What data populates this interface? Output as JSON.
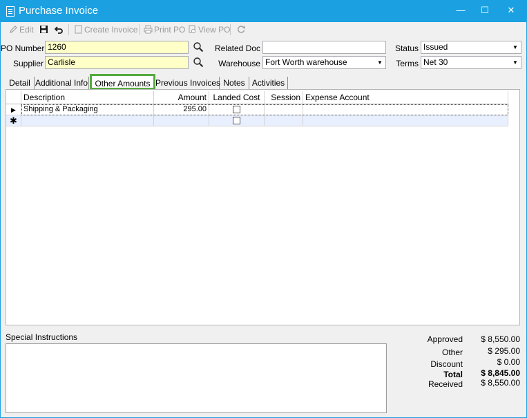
{
  "window": {
    "title": "Purchase Invoice",
    "accent_color": "#1ba1e2",
    "minimize_glyph": "—",
    "maximize_glyph": "☐",
    "close_glyph": "✕"
  },
  "toolbar": {
    "edit": "Edit",
    "create_invoice": "Create Invoice",
    "print_po": "Print PO",
    "view_po": "View PO"
  },
  "form": {
    "po_number_label": "PO Number",
    "po_number_value": "1260",
    "supplier_label": "Supplier",
    "supplier_value": "Carlisle",
    "related_doc_label": "Related Doc",
    "related_doc_value": "",
    "warehouse_label": "Warehouse",
    "warehouse_value": "Fort Worth warehouse",
    "status_label": "Status",
    "status_value": "Issued",
    "terms_label": "Terms",
    "terms_value": "Net 30"
  },
  "tabs": [
    {
      "label": "Detail"
    },
    {
      "label": "Additional Info"
    },
    {
      "label": "Other Amounts"
    },
    {
      "label": "Previous Invoices"
    },
    {
      "label": "Notes"
    },
    {
      "label": "Activities"
    }
  ],
  "active_tab": "Other Amounts",
  "active_tab_highlight_color": "#56ab3f",
  "grid": {
    "columns": [
      "Description",
      "Amount",
      "Landed Cost",
      "Session",
      "Expense Account"
    ],
    "rows": [
      {
        "description": "Shipping & Packaging",
        "amount": "295.00",
        "landed_cost": false,
        "session": "",
        "expense_account": ""
      }
    ],
    "current_row_glyph": "▶",
    "new_row_glyph": "✱"
  },
  "special_instructions": {
    "label": "Special Instructions",
    "value": ""
  },
  "totals": {
    "approved_label": "Approved",
    "approved_value": "$ 8,550.00",
    "other_label": "Other",
    "other_value": "$ 295.00",
    "discount_label": "Discount",
    "discount_value": "$ 0.00",
    "total_label": "Total",
    "total_value": "$ 8,845.00",
    "received_label": "Received",
    "received_value": "$ 8,550.00"
  }
}
